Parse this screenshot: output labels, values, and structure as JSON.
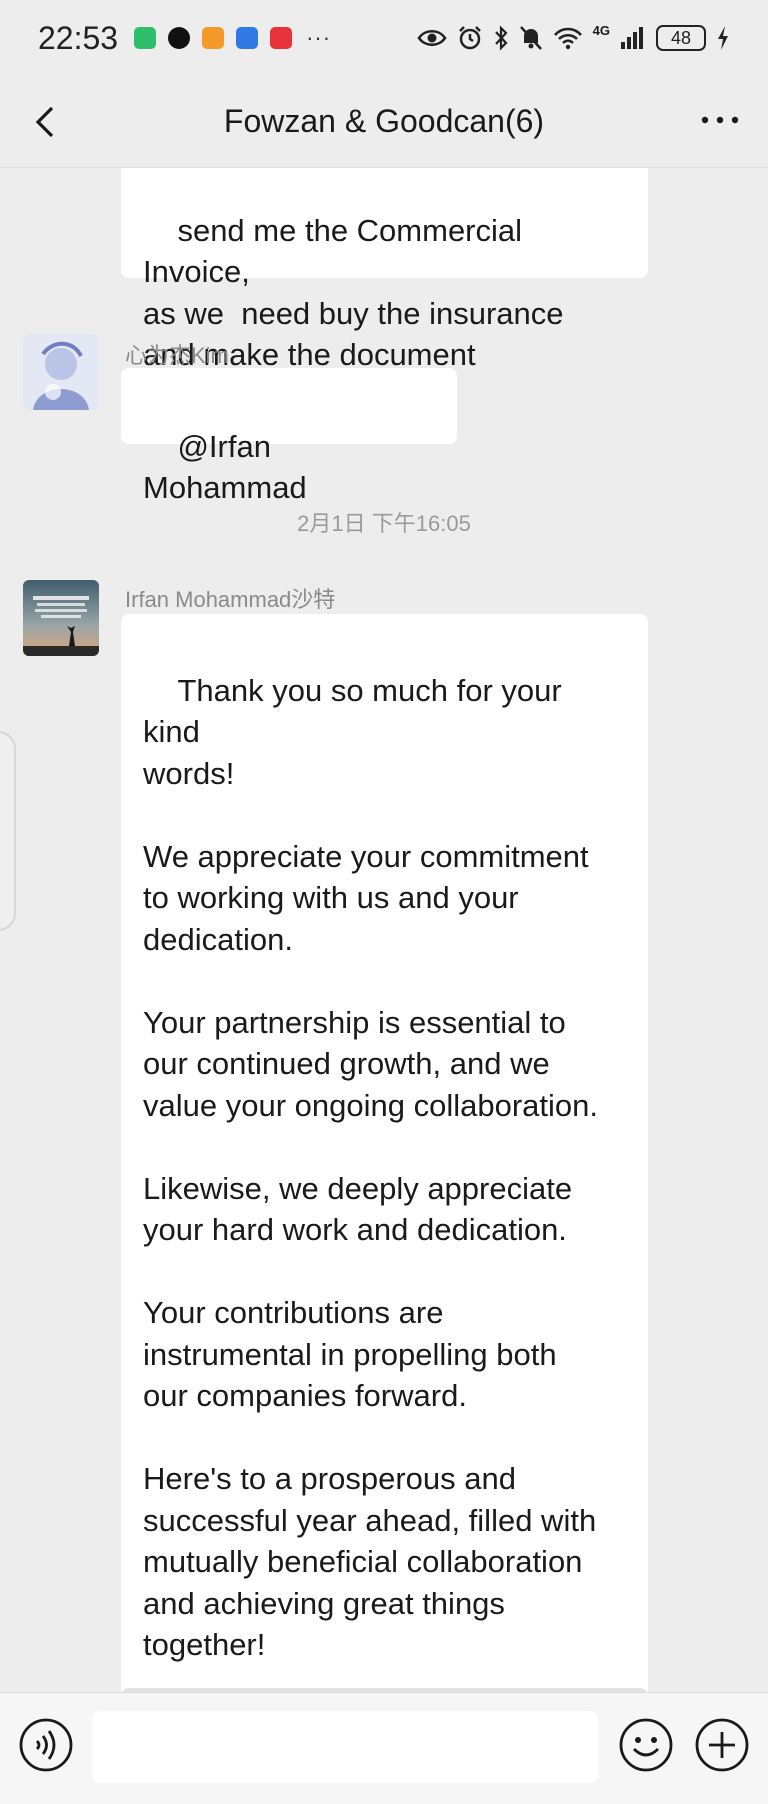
{
  "status_bar": {
    "time": "22:53",
    "network": "4G",
    "battery": "48",
    "more_indicator": "···",
    "app_icons": [
      "hourglass-app-icon",
      "qq-icon",
      "orange-app-icon",
      "blue-app-icon",
      "red-app-icon"
    ],
    "app_icon_colors": [
      "#2fbf6a",
      "#111111",
      "#f39a2b",
      "#2f7ae5",
      "#e8323c"
    ]
  },
  "header": {
    "title": "Fowzan & Goodcan(6)",
    "back_icon": "chevron-left-icon",
    "more_icon": "more-dots-icon"
  },
  "chat": {
    "messages": [
      {
        "text": "send me the Commercial Invoice,\nas we  need buy the insurance\nand make the document"
      },
      {
        "sender": "心为杰Kim",
        "text": "@Irfan Mohammad"
      },
      {
        "time_separator": "2月1日 下午16:05"
      },
      {
        "sender": "Irfan Mohammad沙特",
        "text": "Thank you so much for your kind\nwords!\n\nWe appreciate your commitment\nto working with us and your\ndedication.\n\nYour partnership is essential to\nour continued growth, and we\nvalue your ongoing collaboration.\n\nLikewise, we deeply appreciate\nyour hard work and dedication.\n\nYour contributions are\ninstrumental in propelling both\nour companies forward.\n\nHere's to a prosperous and\nsuccessful year ahead, filled with\nmutually beneficial collaboration\nand achieving great things\ntogether!\n\nGood work Good can ",
        "emojis": [
          "🙏",
          "🤝",
          "🌹"
        ]
      }
    ]
  },
  "input_bar": {
    "voice_icon": "voice-icon",
    "emoji_icon": "smiley-icon",
    "plus_icon": "plus-circle-icon"
  },
  "colors": {
    "background": "#ededed",
    "bubble": "#ffffff",
    "sender_text": "#8a8a8a"
  }
}
